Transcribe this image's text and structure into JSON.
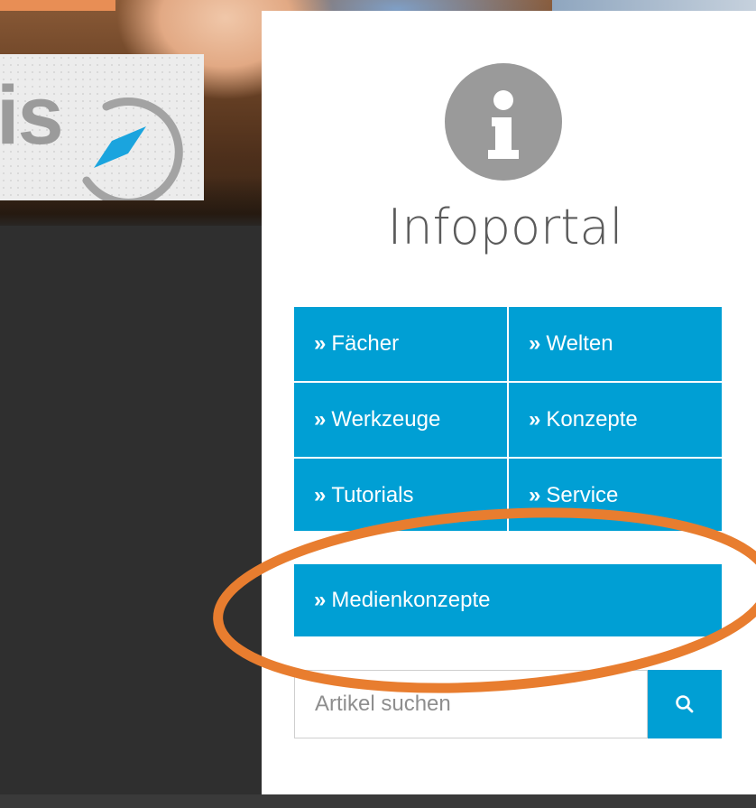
{
  "logo": {
    "text": "is"
  },
  "panel": {
    "title": "Infoportal"
  },
  "nav": [
    {
      "label": "Fächer"
    },
    {
      "label": "Welten"
    },
    {
      "label": "Werkzeuge"
    },
    {
      "label": "Konzepte"
    },
    {
      "label": "Tutorials"
    },
    {
      "label": "Service"
    }
  ],
  "highlight": {
    "label": "Medienkonzepte"
  },
  "arrow_glyph": "»",
  "search": {
    "placeholder": "Artikel suchen"
  },
  "icons": {
    "info": "info-icon",
    "search": "search-icon"
  },
  "colors": {
    "accent": "#009fd4",
    "highlight": "#e87d2f",
    "icon_gray": "#9a9a9a"
  }
}
